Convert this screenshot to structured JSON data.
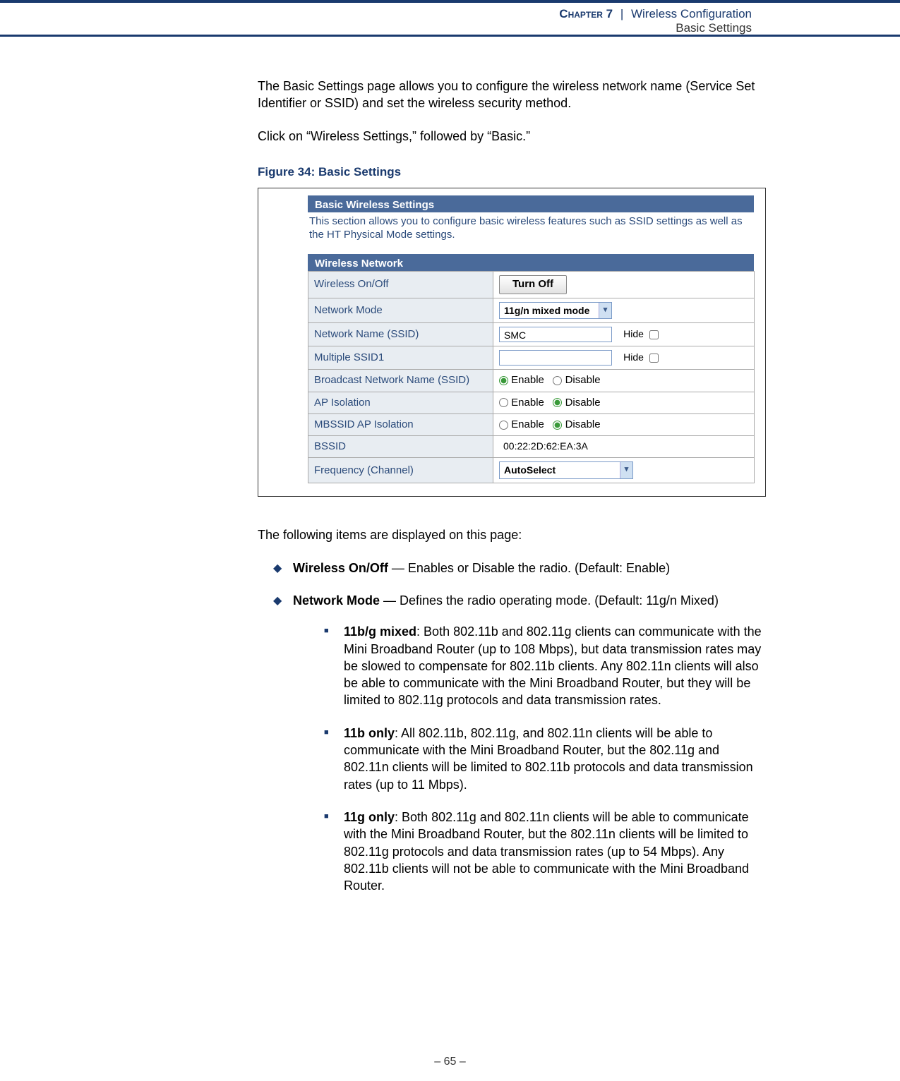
{
  "header": {
    "chapter_label": "Chapter 7",
    "separator": "|",
    "topic": "Wireless Configuration",
    "subtitle": "Basic Settings"
  },
  "intro_para": "The Basic Settings page allows you to configure the wireless network name (Service Set Identifier or SSID) and set the wireless security method.",
  "nav_para": "Click on “Wireless Settings,” followed by “Basic.”",
  "figure_caption": "Figure 34:  Basic Settings",
  "screenshot": {
    "panel1_title": "Basic Wireless Settings",
    "panel1_desc": "This section allows you to configure basic wireless features such as SSID settings as well as the HT Physical Mode settings.",
    "panel2_title": "Wireless Network",
    "rows": {
      "wireless_onoff": {
        "label": "Wireless On/Off",
        "button": "Turn Off"
      },
      "network_mode": {
        "label": "Network Mode",
        "value": "11g/n mixed mode"
      },
      "ssid": {
        "label": "Network Name (SSID)",
        "value": "SMC",
        "hide_label": "Hide"
      },
      "mssid1": {
        "label": "Multiple SSID1",
        "value": "",
        "hide_label": "Hide"
      },
      "broadcast": {
        "label": "Broadcast Network Name (SSID)",
        "enable": "Enable",
        "disable": "Disable"
      },
      "ap_iso": {
        "label": "AP Isolation",
        "enable": "Enable",
        "disable": "Disable"
      },
      "mbssid_iso": {
        "label": "MBSSID AP Isolation",
        "enable": "Enable",
        "disable": "Disable"
      },
      "bssid": {
        "label": "BSSID",
        "value": "00:22:2D:62:EA:3A"
      },
      "freq": {
        "label": "Frequency (Channel)",
        "value": "AutoSelect"
      }
    }
  },
  "items_intro": "The following items are displayed on this page:",
  "bullets": {
    "wireless_onoff": {
      "title": "Wireless On/Off",
      "text": " — Enables or Disable the radio. (Default: Enable)"
    },
    "network_mode": {
      "title": "Network Mode",
      "text": " — Defines the radio operating mode. (Default: 11g/n Mixed)"
    }
  },
  "subbullets": {
    "b_g_mixed": {
      "title": "11b/g mixed",
      "text": ": Both 802.11b and 802.11g clients can communicate with the Mini Broadband Router (up to 108 Mbps), but data transmission rates may be slowed to compensate for 802.11b clients. Any 802.11n clients will also be able to communicate with the Mini Broadband Router, but they will be limited to 802.11g protocols and data transmission rates."
    },
    "b_only": {
      "title": "11b only",
      "text": ": All 802.11b, 802.11g, and 802.11n clients will be able to communicate with the Mini Broadband Router, but the 802.11g and 802.11n clients will be limited to 802.11b protocols and data transmission rates (up to 11 Mbps)."
    },
    "g_only": {
      "title": "11g only",
      "text": ": Both 802.11g and 802.11n clients will be able to communicate with the Mini Broadband Router, but the 802.11n clients will be limited to 802.11g protocols and data transmission rates (up to 54 Mbps). Any 802.11b clients will not be able to communicate with the Mini Broadband Router."
    }
  },
  "page_number": "–  65  –"
}
